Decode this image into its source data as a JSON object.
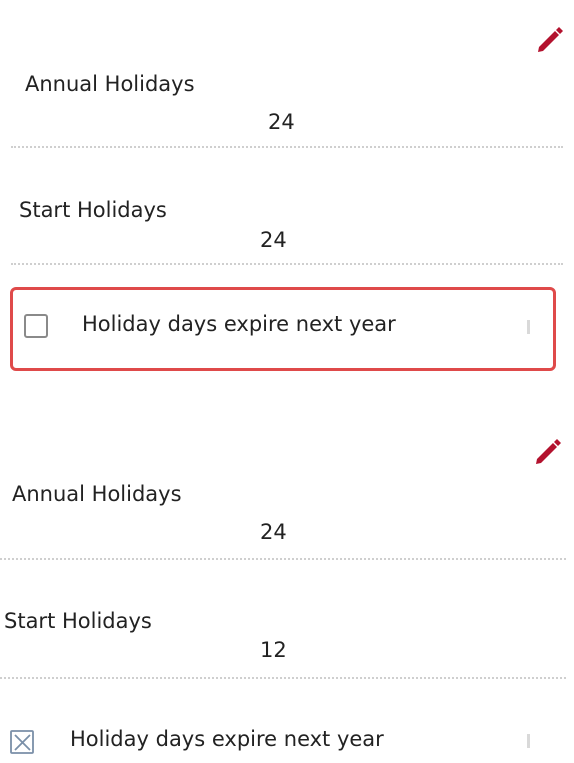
{
  "section1": {
    "annual_label": "Annual Holidays",
    "annual_value": "24",
    "start_label": "Start Holidays",
    "start_value": "24",
    "checkbox_label": "Holiday days expire next year",
    "checkbox_checked": false
  },
  "section2": {
    "annual_label": "Annual Holidays",
    "annual_value": "24",
    "start_label": "Start Holidays",
    "start_value": "12",
    "checkbox_label": "Holiday days expire next year",
    "checkbox_checked": true
  },
  "colors": {
    "edit_icon": "#b3122e",
    "highlight_border": "#df4a4a",
    "checkbox_border": "#7a8fa8",
    "divider": "#cfcfcf"
  },
  "icons": {
    "edit": "pencil-icon",
    "checkbox_unchecked": "checkbox-unchecked-icon",
    "checkbox_checked": "checkbox-checked-icon"
  }
}
